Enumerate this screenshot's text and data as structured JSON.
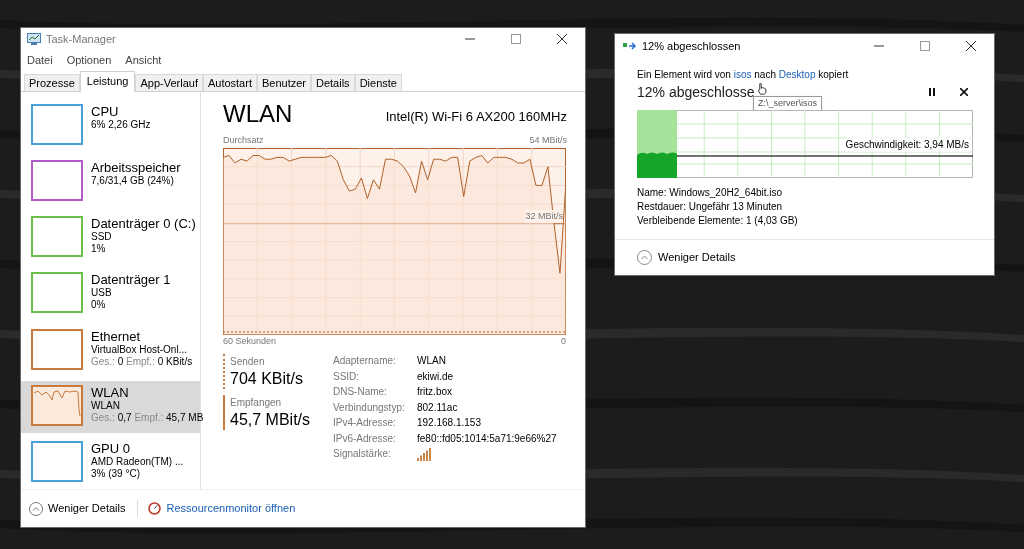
{
  "task_manager": {
    "title": "Task-Manager",
    "menu": [
      "Datei",
      "Optionen",
      "Ansicht"
    ],
    "tabs": [
      {
        "label": "Prozesse",
        "selected": false
      },
      {
        "label": "Leistung",
        "selected": true
      },
      {
        "label": "App-Verlauf",
        "selected": false
      },
      {
        "label": "Autostart",
        "selected": false
      },
      {
        "label": "Benutzer",
        "selected": false
      },
      {
        "label": "Details",
        "selected": false
      },
      {
        "label": "Dienste",
        "selected": false
      }
    ],
    "sidebar": [
      {
        "title": "CPU",
        "lines": [
          "6%  2,26 GHz"
        ],
        "color": "#4aa0d8",
        "selected": false
      },
      {
        "title": "Arbeitsspeicher",
        "lines": [
          "7,6/31,4 GB (24%)"
        ],
        "color": "#b05cc8",
        "selected": false
      },
      {
        "title": "Datenträger 0 (C:)",
        "lines": [
          "SSD",
          "1%"
        ],
        "color": "#6cc04a",
        "selected": false
      },
      {
        "title": "Datenträger 1",
        "lines": [
          "USB",
          "0%"
        ],
        "color": "#6cc04a",
        "selected": false
      },
      {
        "title": "Ethernet",
        "lines": [
          "VirtualBox Host-Onl..."
        ],
        "rate": {
          "send_label": "Ges.:",
          "send": "0",
          "recv_label": "Empf.:",
          "recv": "0 KBit/s"
        },
        "color": "#c87a3c",
        "selected": false
      },
      {
        "title": "WLAN",
        "lines": [
          "WLAN"
        ],
        "rate": {
          "send_label": "Ges.:",
          "send": "0,7",
          "recv_label": "Empf.:",
          "recv": "45,7 MB"
        },
        "color": "#c87a3c",
        "selected": true
      },
      {
        "title": "GPU 0",
        "lines": [
          "AMD Radeon(TM) ...",
          "3%  (39 °C)"
        ],
        "color": "#4aa0d8",
        "selected": false
      }
    ],
    "detail": {
      "title": "WLAN",
      "adapter": "Intel(R) Wi-Fi 6 AX200 160MHz",
      "graph_label": "Durchsatz",
      "max_label": "54 MBit/s",
      "mid_label": "32 MBit/s",
      "time_label": "60 Sekunden",
      "zero_label": "0",
      "send": {
        "label": "Senden",
        "value": "704 KBit/s"
      },
      "receive": {
        "label": "Empfangen",
        "value": "45,7 MBit/s"
      },
      "properties": [
        {
          "label": "Adaptername:",
          "value": "WLAN"
        },
        {
          "label": "SSID:",
          "value": "ekiwi.de"
        },
        {
          "label": "DNS-Name:",
          "value": "fritz.box"
        },
        {
          "label": "Verbindungstyp:",
          "value": "802.11ac"
        },
        {
          "label": "IPv4-Adresse:",
          "value": "192.168.1.153"
        },
        {
          "label": "IPv6-Adresse:",
          "value": "fe80::fd05:1014:5a71:9e66%27"
        },
        {
          "label": "Signalstärke:",
          "kind": "signal"
        }
      ]
    },
    "footer": {
      "less": "Weniger Details",
      "monitor": "Ressourcenmonitor öffnen"
    }
  },
  "copy_dialog": {
    "title": "12% abgeschlossen",
    "message": {
      "before": "Ein Element wird von",
      "source": "isos",
      "middle": "nach",
      "target": "Desktop",
      "after": "kopiert"
    },
    "heading": "12% abgeschlosse",
    "tooltip": "Z:\\_server\\isos",
    "level": 0.12,
    "speed": "Geschwindigkeit: 3,94 MB/s",
    "details": [
      {
        "label": "Name:",
        "value": "Windows_20H2_64bit.iso"
      },
      {
        "label": "Restdauer:",
        "value": "Ungefähr 13 Minuten"
      },
      {
        "label": "Verbleibende Elemente:",
        "value": "1 (4,03 GB)"
      }
    ],
    "less": "Weniger Details"
  }
}
